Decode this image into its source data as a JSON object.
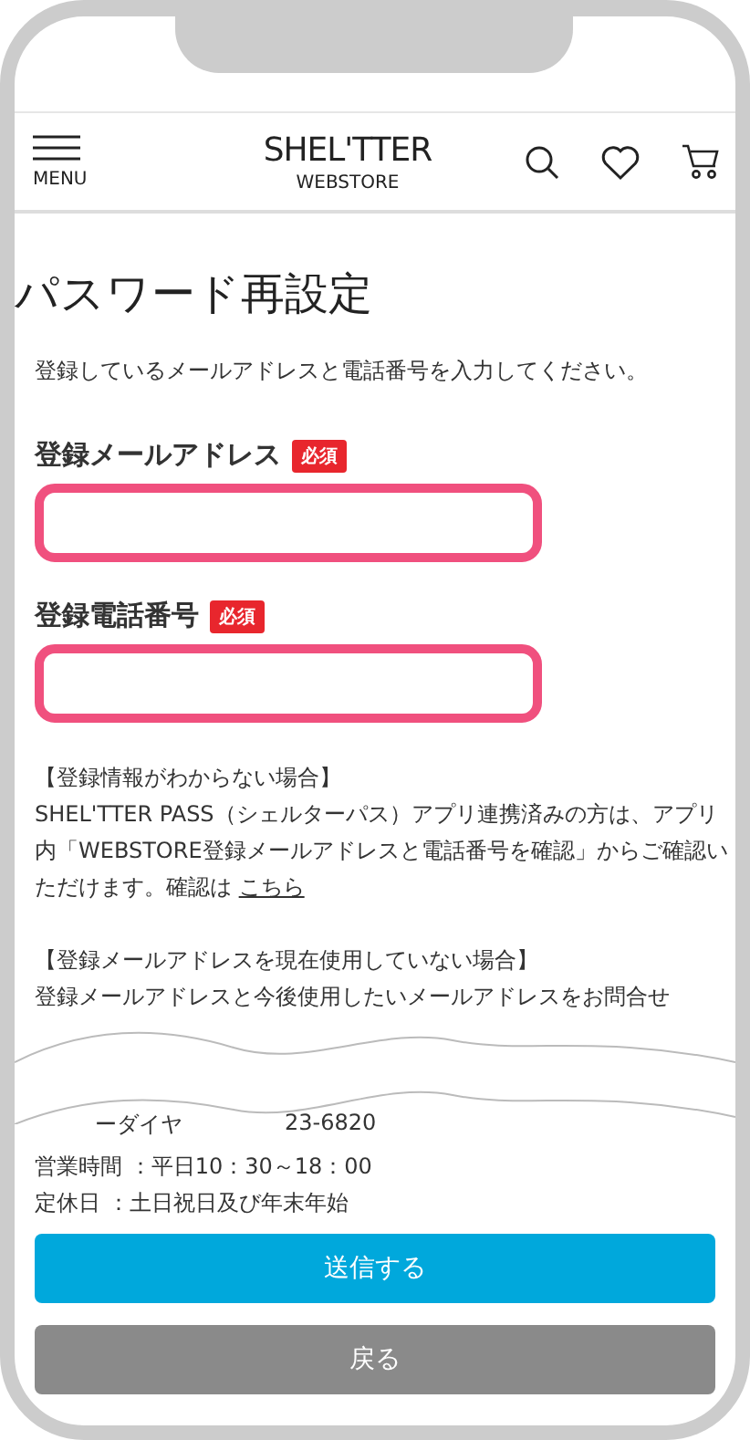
{
  "header": {
    "menu_label": "MENU",
    "logo": "SHEL'TTER",
    "logo_sub": "WEBSTORE"
  },
  "title": "パスワード再設定",
  "intro": "登録しているメールアドレスと電話番号を入力してください。",
  "fields": [
    {
      "label": "登録メールアドレス",
      "badge": "必須"
    },
    {
      "label": "登録電話番号",
      "badge": "必須"
    }
  ],
  "info": [
    {
      "kind": "heading",
      "text": "【登録情報がわからない場合】"
    },
    {
      "kind": "para",
      "text": "SHEL'TTER PASS（シェルターパス）アプリ連携済みの方は、アプリ内「WEBSTORE登録メールアドレスと電話番号を確認」からご確認いただけます。確認は",
      "link": "こちら"
    },
    {
      "kind": "gap"
    },
    {
      "kind": "heading",
      "text": "【登録メールアドレスを現在使用していない場合】"
    },
    {
      "kind": "para",
      "text": "登録メールアドレスと今後使用したいメールアドレスをお問合せ"
    }
  ],
  "partial_line": [
    "ーダイヤ",
    "23-6820"
  ],
  "hours": [
    "営業時間 ：平日10：30～18：00",
    "定休日 ：土日祝日及び年末年始"
  ],
  "buttons": [
    {
      "kind": "primary",
      "label": "送信する"
    },
    {
      "kind": "secondary",
      "label": "戻る"
    }
  ]
}
